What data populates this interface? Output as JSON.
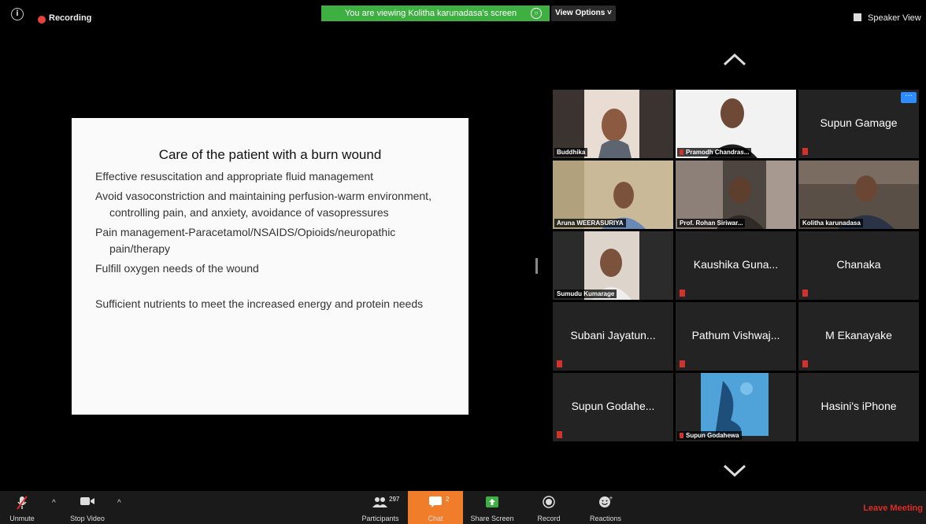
{
  "topbar": {
    "info_label": "i",
    "recording_label": "Recording",
    "viewing_banner": "You are viewing Kolitha karunadasa's screen",
    "view_options_label": "View Options",
    "speaker_view_label": "Speaker View"
  },
  "slide": {
    "title": "Care of the patient with a burn wound",
    "items": [
      "Effective resuscitation and appropriate fluid management",
      "Avoid vasoconstriction and maintaining perfusion-warm environment, controlling pain, and anxiety, avoidance of vasopressures",
      "Pain management-Paracetamol/NSAIDS/Opioids/neuropathic pain/therapy",
      "Fulfill oxygen needs of the wound",
      "Sufficient nutrients to meet the increased energy and protein needs"
    ]
  },
  "participants": [
    {
      "name": "Buddhika",
      "video": true
    },
    {
      "name": "Pramodh Chandras...",
      "video": true
    },
    {
      "name": "Supun Gamage",
      "video": false
    },
    {
      "name": "Aruna WEERASURIYA",
      "video": true
    },
    {
      "name": "Prof. Rohan Siriwar...",
      "video": true
    },
    {
      "name": "Kolitha karunadasa",
      "video": true,
      "active": true
    },
    {
      "name": "Sumudu Kumarage",
      "video": true
    },
    {
      "name": "Kaushika Guna...",
      "video": false
    },
    {
      "name": "Chanaka",
      "video": false
    },
    {
      "name": "Subani Jayatun...",
      "video": false
    },
    {
      "name": "Pathum Vishwaj...",
      "video": false
    },
    {
      "name": "M Ekanayake",
      "video": false
    },
    {
      "name": "Supun Godahe...",
      "video": false
    },
    {
      "name": "Supun Godahewa",
      "video": true
    },
    {
      "name": "Hasini's iPhone",
      "video": false
    }
  ],
  "more_button_label": "···",
  "toolbar": {
    "unmute_label": "Unmute",
    "stop_video_label": "Stop Video",
    "participants_label": "Participants",
    "participants_count": "297",
    "chat_label": "Chat",
    "chat_count": "2",
    "share_screen_label": "Share Screen",
    "record_label": "Record",
    "reactions_label": "Reactions",
    "leave_label": "Leave Meeting"
  },
  "colors": {
    "banner_green": "#3db041",
    "chat_orange": "#f07d2a",
    "active_speaker": "#c7e43a",
    "leave_red": "#e02b27"
  }
}
